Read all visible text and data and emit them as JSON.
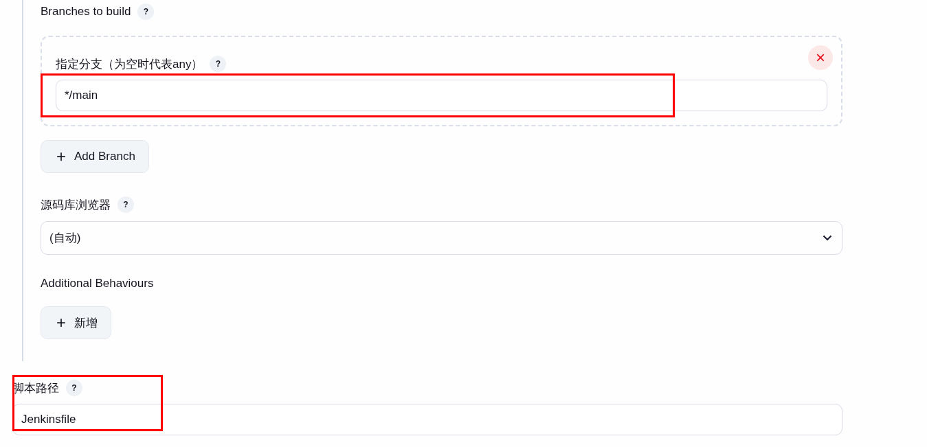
{
  "branches": {
    "label": "Branches to build",
    "help": "?",
    "items": [
      {
        "label": "指定分支（为空时代表any）",
        "help": "?",
        "value": "*/main",
        "highlighted": true,
        "close": "×"
      }
    ],
    "add_button": {
      "icon": "+",
      "label": "Add Branch"
    }
  },
  "browser": {
    "label": "源码库浏览器",
    "help": "?",
    "value": "(自动)"
  },
  "behaviours": {
    "label": "Additional Behaviours",
    "add_button": {
      "icon": "+",
      "label": "新增"
    }
  },
  "script_path": {
    "label": "脚本路径",
    "help": "?",
    "value": "Jenkinsfile",
    "highlighted": true
  }
}
